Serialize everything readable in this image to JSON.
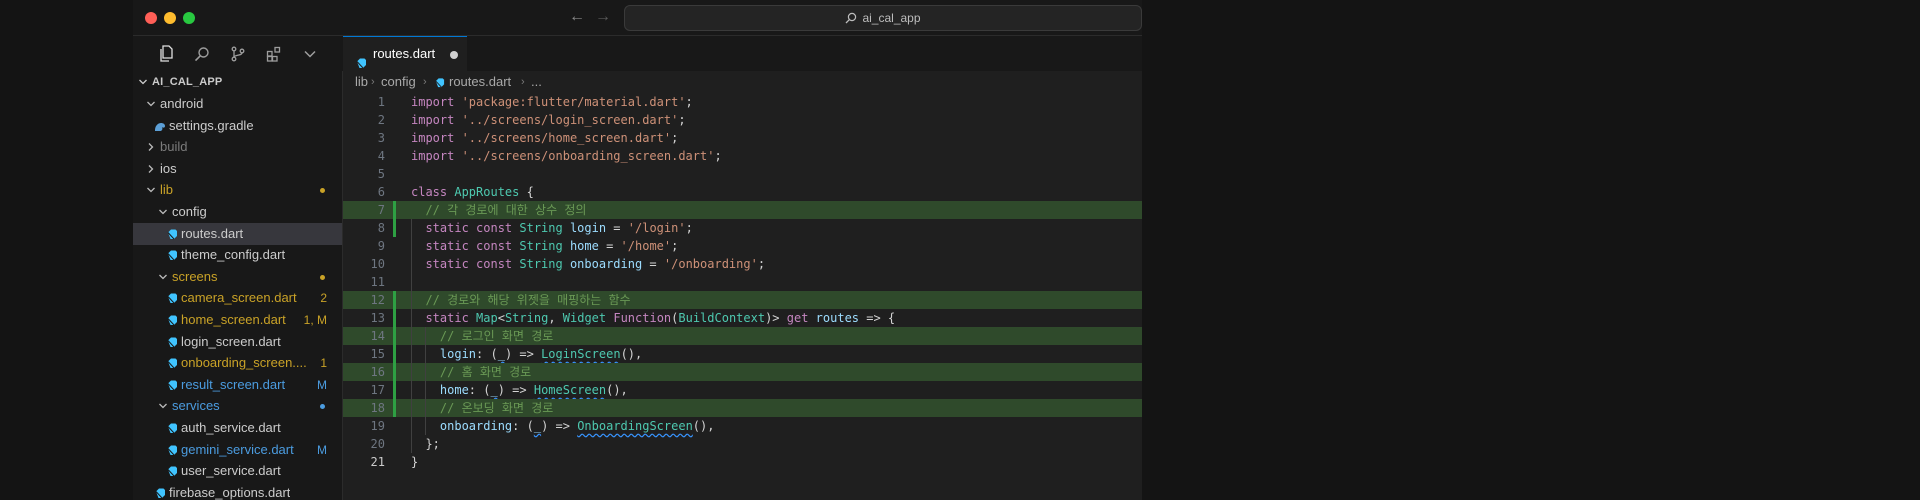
{
  "window": {
    "search_text": "ai_cal_app",
    "nav_back": "←",
    "nav_forward": "→"
  },
  "activity_bar": [
    {
      "name": "explorer-icon"
    },
    {
      "name": "search-icon"
    },
    {
      "name": "source-control-icon"
    },
    {
      "name": "extensions-icon"
    },
    {
      "name": "chevron-down-icon"
    }
  ],
  "explorer": {
    "root": "AI_CAL_APP",
    "items": [
      {
        "label": "android",
        "type": "folder",
        "open": true,
        "indent": 1,
        "color": "default"
      },
      {
        "label": "settings.gradle",
        "type": "file",
        "icon": "gradle",
        "indent": 1,
        "color": "default"
      },
      {
        "label": "build",
        "type": "folder",
        "open": false,
        "indent": 1,
        "color": "dim"
      },
      {
        "label": "ios",
        "type": "folder",
        "open": false,
        "indent": 1,
        "color": "default"
      },
      {
        "label": "lib",
        "type": "folder",
        "open": true,
        "indent": 1,
        "color": "mod",
        "dot": "#c9a227"
      },
      {
        "label": "config",
        "type": "folder",
        "open": true,
        "indent": 2,
        "color": "default"
      },
      {
        "label": "routes.dart",
        "type": "file",
        "icon": "dart",
        "indent": 2,
        "color": "default",
        "selected": true
      },
      {
        "label": "theme_config.dart",
        "type": "file",
        "icon": "dart",
        "indent": 2,
        "color": "default"
      },
      {
        "label": "screens",
        "type": "folder",
        "open": true,
        "indent": 2,
        "color": "mod",
        "dot": "#c9a227"
      },
      {
        "label": "camera_screen.dart",
        "type": "file",
        "icon": "dart",
        "indent": 2,
        "color": "mod",
        "badge": "2"
      },
      {
        "label": "home_screen.dart",
        "type": "file",
        "icon": "dart",
        "indent": 2,
        "color": "mod",
        "badge": "1, M"
      },
      {
        "label": "login_screen.dart",
        "type": "file",
        "icon": "dart",
        "indent": 2,
        "color": "default"
      },
      {
        "label": "onboarding_screen....",
        "type": "file",
        "icon": "dart",
        "indent": 2,
        "color": "mod",
        "badge": "1"
      },
      {
        "label": "result_screen.dart",
        "type": "file",
        "icon": "dart",
        "indent": 2,
        "color": "git",
        "badge": "M"
      },
      {
        "label": "services",
        "type": "folder",
        "open": true,
        "indent": 2,
        "color": "git",
        "dot": "#4b9ce0"
      },
      {
        "label": "auth_service.dart",
        "type": "file",
        "icon": "dart",
        "indent": 2,
        "color": "default"
      },
      {
        "label": "gemini_service.dart",
        "type": "file",
        "icon": "dart",
        "indent": 2,
        "color": "git",
        "badge": "M"
      },
      {
        "label": "user_service.dart",
        "type": "file",
        "icon": "dart",
        "indent": 2,
        "color": "default"
      },
      {
        "label": "firebase_options.dart",
        "type": "file",
        "icon": "dart",
        "indent": 1,
        "color": "default"
      }
    ]
  },
  "editor": {
    "tab": {
      "label": "routes.dart",
      "unsaved": true
    },
    "breadcrumb": [
      "lib",
      "config",
      "routes.dart",
      "..."
    ],
    "lines": [
      {
        "n": "1",
        "tokens": [
          [
            "kw",
            "import "
          ],
          [
            "str",
            "'package:flutter/material.dart'"
          ],
          [
            "pl",
            ";"
          ]
        ]
      },
      {
        "n": "2",
        "tokens": [
          [
            "kw",
            "import "
          ],
          [
            "str",
            "'../screens/login_screen.dart'"
          ],
          [
            "pl",
            ";"
          ]
        ]
      },
      {
        "n": "3",
        "tokens": [
          [
            "kw",
            "import "
          ],
          [
            "str",
            "'../screens/home_screen.dart'"
          ],
          [
            "pl",
            ";"
          ]
        ]
      },
      {
        "n": "4",
        "tokens": [
          [
            "kw",
            "import "
          ],
          [
            "str",
            "'../screens/onboarding_screen.dart'"
          ],
          [
            "pl",
            ";"
          ]
        ]
      },
      {
        "n": "5",
        "tokens": []
      },
      {
        "n": "6",
        "tokens": [
          [
            "kw",
            "class "
          ],
          [
            "typ",
            "AppRoutes"
          ],
          [
            "pl",
            " {"
          ]
        ]
      },
      {
        "n": "7",
        "tokens": [
          [
            "cmt",
            "  // 각 경로에 대한 상수 정의"
          ]
        ],
        "hl": true,
        "git": true
      },
      {
        "n": "8",
        "tokens": [
          [
            "kw",
            "  static const "
          ],
          [
            "typ",
            "String "
          ],
          [
            "var",
            "login"
          ],
          [
            "pl",
            " = "
          ],
          [
            "str",
            "'/login'"
          ],
          [
            "pl",
            ";"
          ]
        ],
        "git": true
      },
      {
        "n": "9",
        "tokens": [
          [
            "kw",
            "  static const "
          ],
          [
            "typ",
            "String "
          ],
          [
            "var",
            "home"
          ],
          [
            "pl",
            " = "
          ],
          [
            "str",
            "'/home'"
          ],
          [
            "pl",
            ";"
          ]
        ]
      },
      {
        "n": "10",
        "tokens": [
          [
            "kw",
            "  static const "
          ],
          [
            "typ",
            "String "
          ],
          [
            "var",
            "onboarding"
          ],
          [
            "pl",
            " = "
          ],
          [
            "str",
            "'/onboarding'"
          ],
          [
            "pl",
            ";"
          ]
        ]
      },
      {
        "n": "11",
        "tokens": []
      },
      {
        "n": "12",
        "tokens": [
          [
            "cmt",
            "  // 경로와 해당 위젯을 매핑하는 함수"
          ]
        ],
        "hl": true,
        "git": true
      },
      {
        "n": "13",
        "tokens": [
          [
            "kw",
            "  static "
          ],
          [
            "typ",
            "Map"
          ],
          [
            "pl",
            "<"
          ],
          [
            "typ",
            "String"
          ],
          [
            "pl",
            ", "
          ],
          [
            "typ",
            "Widget "
          ],
          [
            "kw",
            "Function"
          ],
          [
            "pl",
            "("
          ],
          [
            "typ",
            "BuildContext"
          ],
          [
            "pl",
            ")> "
          ],
          [
            "kw",
            "get "
          ],
          [
            "var",
            "routes"
          ],
          [
            "pl",
            " => {"
          ]
        ],
        "git": true
      },
      {
        "n": "14",
        "tokens": [
          [
            "cmt",
            "    // 로그인 화면 경로"
          ]
        ],
        "hl": true,
        "git": true
      },
      {
        "n": "15",
        "tokens": [
          [
            "var",
            "    login"
          ],
          [
            "pl",
            ": ("
          ],
          [
            "var",
            "_"
          ],
          [
            "pl",
            ") => "
          ],
          [
            "typ",
            "LoginScreen"
          ],
          [
            "pl",
            "(),"
          ]
        ],
        "git": true,
        "sq": true
      },
      {
        "n": "16",
        "tokens": [
          [
            "cmt",
            "    // 홈 화면 경로"
          ]
        ],
        "hl": true,
        "git": true
      },
      {
        "n": "17",
        "tokens": [
          [
            "var",
            "    home"
          ],
          [
            "pl",
            ": ("
          ],
          [
            "var",
            "_"
          ],
          [
            "pl",
            ") => "
          ],
          [
            "typ",
            "HomeScreen"
          ],
          [
            "pl",
            "(),"
          ]
        ],
        "git": true,
        "sq": true
      },
      {
        "n": "18",
        "tokens": [
          [
            "cmt",
            "    // 온보딩 화면 경로"
          ]
        ],
        "hl": true,
        "git": true
      },
      {
        "n": "19",
        "tokens": [
          [
            "var",
            "    onboarding"
          ],
          [
            "pl",
            ": ("
          ],
          [
            "var",
            "_"
          ],
          [
            "pl",
            ") => "
          ],
          [
            "typ",
            "OnboardingScreen"
          ],
          [
            "pl",
            "(),"
          ]
        ],
        "sq": true
      },
      {
        "n": "20",
        "tokens": [
          [
            "pl",
            "  };"
          ]
        ]
      },
      {
        "n": "21",
        "tokens": [
          [
            "pl",
            "}"
          ]
        ],
        "active": true
      }
    ]
  },
  "colors": {
    "accent": "#0078d4",
    "modified": "#c9a227",
    "git_modified": "#4b9ce0",
    "line_highlight": "#2f4a2b",
    "git_bar": "#2ea043"
  }
}
